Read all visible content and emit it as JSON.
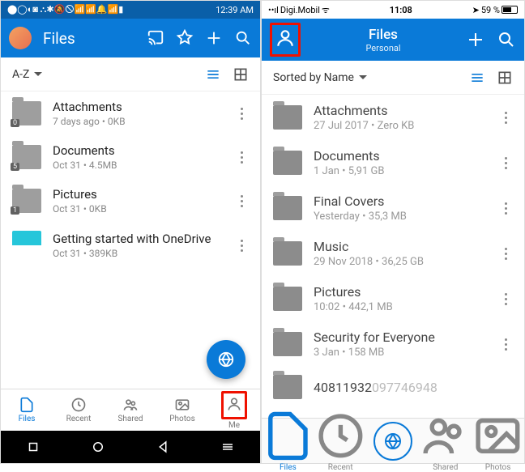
{
  "android": {
    "status": {
      "icons": "⬤◯◐◙ ⛬✱🔕🛇📶📶🔔📶▮",
      "time": "12:39 AM"
    },
    "title": "Files",
    "sort": "A-Z",
    "items": [
      {
        "name": "Attachments",
        "meta": "7 days ago • 0KB",
        "badge": "0"
      },
      {
        "name": "Documents",
        "meta": "Oct 31 • 4.5MB",
        "badge": "5"
      },
      {
        "name": "Pictures",
        "meta": "Oct 31 • 0KB",
        "badge": "1"
      },
      {
        "name": "Getting started with OneDrive",
        "meta": "Oct 31 • 389KB",
        "thumb": true
      }
    ],
    "tabs": [
      {
        "label": "Files",
        "active": true
      },
      {
        "label": "Recent"
      },
      {
        "label": "Shared"
      },
      {
        "label": "Photos"
      },
      {
        "label": "Me",
        "highlight": true
      }
    ]
  },
  "ios": {
    "status": {
      "carrier": "Digi.Mobil",
      "sig": "📶",
      "wifi": "📶",
      "time": "11:08",
      "loc": "➤",
      "batt": "59 %",
      "batticon": "🔋"
    },
    "title": "Files",
    "subtitle": "Personal",
    "sort": "Sorted by Name",
    "items": [
      {
        "name": "Attachments",
        "meta": "27 Jul 2017 • Zero KB"
      },
      {
        "name": "Documents",
        "meta": "1 Jan • 5,91 GB"
      },
      {
        "name": "Final Covers",
        "meta": "Yesterday • 35,3 MB"
      },
      {
        "name": "Music",
        "meta": "29 Nov 2018 • 36,25 GB"
      },
      {
        "name": "Pictures",
        "meta": "10:02 • 442,1 MB"
      },
      {
        "name": "Security for Everyone",
        "meta": "3 Jan • 158 MB"
      },
      {
        "name": "40811932",
        "meta": "097746948"
      }
    ],
    "tabs": [
      {
        "label": "Files",
        "active": true
      },
      {
        "label": "Recent"
      },
      {
        "label": ""
      },
      {
        "label": "Shared"
      },
      {
        "label": "Photos"
      }
    ]
  }
}
